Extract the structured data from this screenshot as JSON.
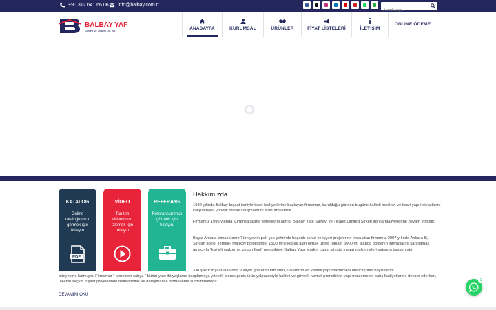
{
  "topbar": {
    "phone": "+90 312 641 66 06",
    "email": "info@balbay.com.tr",
    "socials": [
      {
        "icon": "facebook-icon",
        "color": "#3b5998"
      },
      {
        "icon": "x-icon",
        "color": "#111111"
      },
      {
        "icon": "instagram-icon",
        "color": "#c13584"
      },
      {
        "icon": "linkedin-icon",
        "color": "#0077b5"
      },
      {
        "icon": "youtube-icon",
        "color": "#e00000"
      },
      {
        "icon": "pinterest-icon",
        "color": "#cb2027"
      },
      {
        "icon": "whatsapp-icon",
        "color": "#25d366"
      },
      {
        "icon": "rss-icon",
        "color": "#2aa845"
      }
    ],
    "search_placeholder": "Aranılı yapı..."
  },
  "logo": {
    "name": "BALBAY YAPI",
    "subtitle": "Sanayi ve Ticaret Ltd. Şti."
  },
  "nav": [
    {
      "label": "ANASAYFA",
      "icon": "home-icon",
      "active": true
    },
    {
      "label": "KURUMSAL",
      "icon": "user-icon"
    },
    {
      "label": "ÜRÜNLER",
      "icon": "handshake-icon"
    },
    {
      "label": "FİYAT LİSTELERİ",
      "icon": "megaphone-icon"
    },
    {
      "label": "İLETİŞİM",
      "icon": "info-icon"
    },
    {
      "label": "ONLINE ÖDEME",
      "icon": ""
    }
  ],
  "cards": [
    {
      "title": "KATALOG",
      "desc": "Online kataloğumuzu görmek için tıklayın",
      "icon": "pdf-icon",
      "color": "#1f3a52"
    },
    {
      "title": "VİDEO",
      "desc": "Tanıtım videomuzu izlemek için tıklayın",
      "icon": "play-icon",
      "color": "#e8243a"
    },
    {
      "title": "REFERANS",
      "desc": "Referanslarımızı görmek için tıklayın.",
      "icon": "briefcase-icon",
      "color": "#22b594"
    }
  ],
  "about": {
    "heading": "Hakkımızda",
    "p1": "1982 yılında Balbay İnşaat ismiyle ticari faaliyetlerine başlayan firmamız, kurulduğu günden bugüne kaliteli mesken ve ticari yapı ihtiyaçlarını karşılamaya yönelik olarak çalışmalarını sürdürmektedir.",
    "p2": "Firmamız 1995 yılında kurumsallaşma temellerini atmış, Balbay Yapı Sanayi ve Ticaret Limited Şirketi adıyla faaliyetlerine devam etmiştir.",
    "p3": "Başta Ankara olmak üzere Türkiye'nin pek çok şehrinde başarılı konut ve işyeri projelerine imza atan firmamız 2007 yılında Ankara İli, Sincan İlçesi, Temelli- Malıköy bölgesinde; 1500 m²si kapalı alan olmak üzere toplam 5000 m² alanda bölgenin ihtiyaçlarını karşılamak amacıyla \"kaliteli malzeme, uygun fiyat\" prensibiyle Balbay Yapı Market çatısı altında inşaat malzemeleri satışına başlamıştır.",
    "p4": "3 kuşaktır inşaat alanında faaliyet gösteren firmamız, ülkemizin en kaliteli yapı malzemesi üreticilerinin bayiliklerini",
    "p5": "bünyesine katmıştır. Firmamız \" temelden çatıya \" bütün yapı ihtiyaçlarını karşılamaya yönelik olarak geniş ürün yelpazesiyle kaliteli ve güvenli hizmet prensibiyle yapı malzemeleri satış faaliyetlerine devam ederken, ülkenin seçkin inşaat projelerinde müteahhitlik ve danışmanlık hizmetlerini sürdürmektedir.",
    "read_more": "DEVAMINI OKU"
  },
  "whatsapp": {
    "badge": "1"
  },
  "colors": {
    "brand": "#23275e",
    "accent": "#e8243a"
  }
}
